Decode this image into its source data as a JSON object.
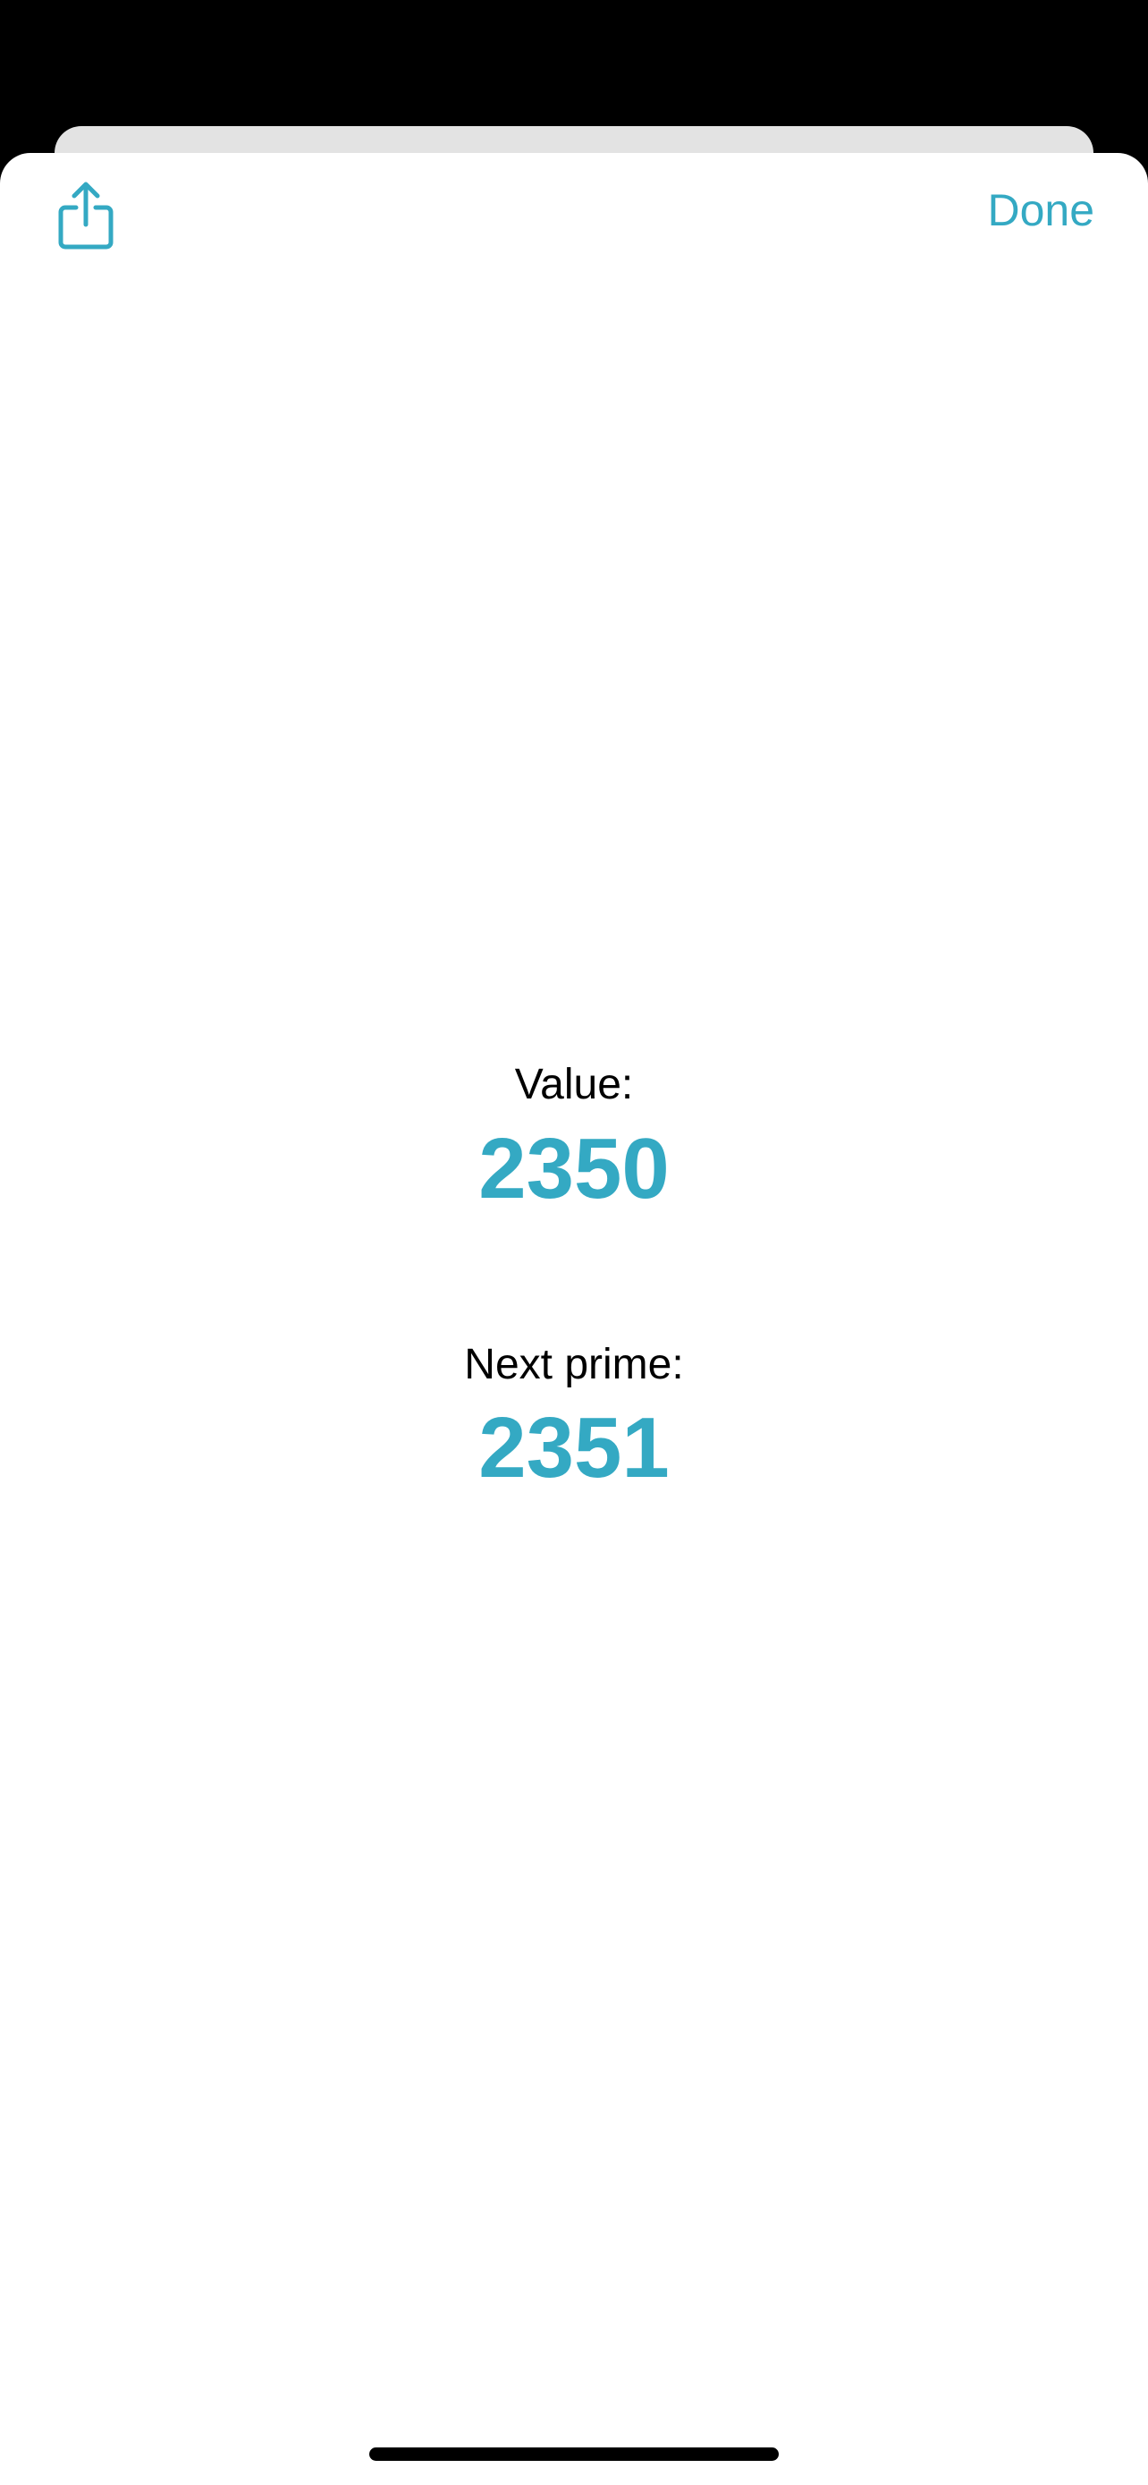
{
  "toolbar": {
    "share_icon": "share-icon",
    "done_label": "Done"
  },
  "content": {
    "value_label": "Value:",
    "value_number": "2350",
    "next_prime_label": "Next prime:",
    "next_prime_number": "2351"
  },
  "colors": {
    "accent": "#34a9c3",
    "background_behind": "#000000",
    "sheet": "#ffffff",
    "back_card": "#e3e3e3"
  }
}
